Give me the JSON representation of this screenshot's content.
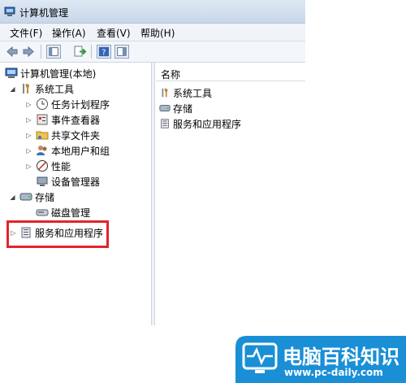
{
  "window": {
    "title": "计算机管理"
  },
  "menu": [
    "文件(F)",
    "操作(A)",
    "查看(V)",
    "帮助(H)"
  ],
  "toolbar": {
    "buttons": [
      "back-icon",
      "forward-icon",
      "console-tree-icon",
      "export-list-icon",
      "help-icon",
      "properties-icon"
    ]
  },
  "tree": {
    "root": "计算机管理(本地)",
    "system_tools": "系统工具",
    "task_scheduler": "任务计划程序",
    "event_viewer": "事件查看器",
    "shared_folders": "共享文件夹",
    "local_users": "本地用户和组",
    "performance": "性能",
    "device_manager": "设备管理器",
    "storage": "存储",
    "disk_management": "磁盘管理",
    "services_apps": "服务和应用程序"
  },
  "list": {
    "header": "名称",
    "items": [
      "系统工具",
      "存储",
      "服务和应用程序"
    ]
  },
  "watermark": {
    "text": "电脑百科知识",
    "url": "www.pc-daily.com"
  },
  "colors": {
    "highlight": "#e1252b",
    "watermark": "#1a8fd6"
  }
}
